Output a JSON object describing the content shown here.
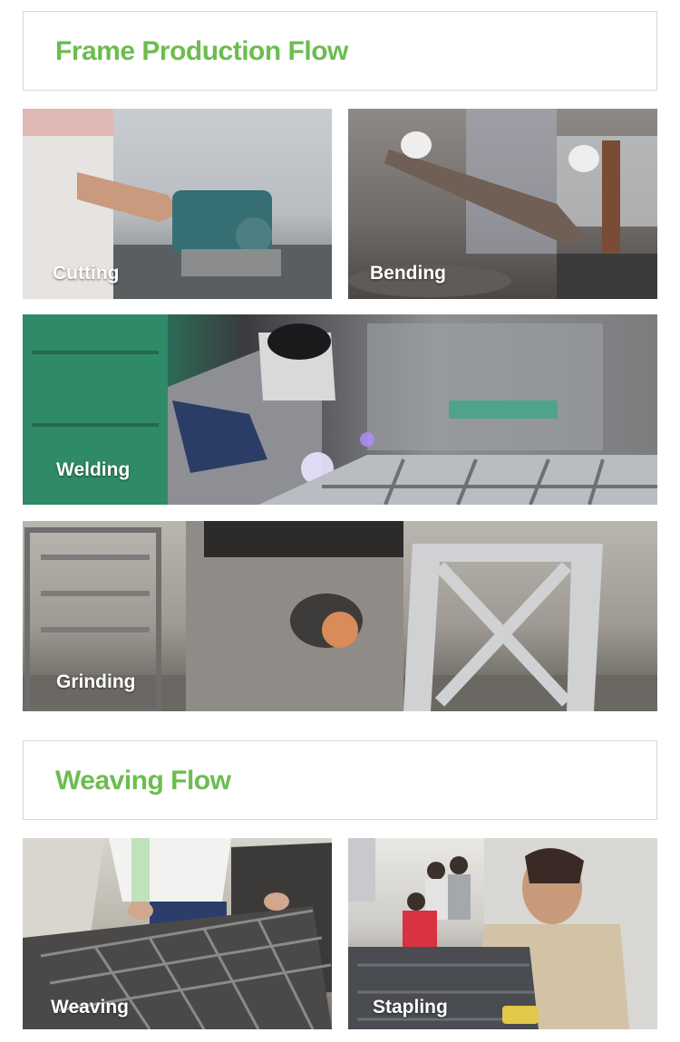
{
  "frame_section": {
    "title": "Frame Production Flow",
    "photos": [
      {
        "caption": "Cutting"
      },
      {
        "caption": "Bending"
      },
      {
        "caption": "Welding"
      },
      {
        "caption": "Grinding"
      }
    ]
  },
  "weaving_section": {
    "title": "Weaving Flow",
    "photos": [
      {
        "caption": "Weaving"
      },
      {
        "caption": "Stapling"
      }
    ]
  },
  "colors": {
    "accent": "#6cbd4f",
    "border": "#d9d9d9",
    "caption": "#ffffff"
  }
}
